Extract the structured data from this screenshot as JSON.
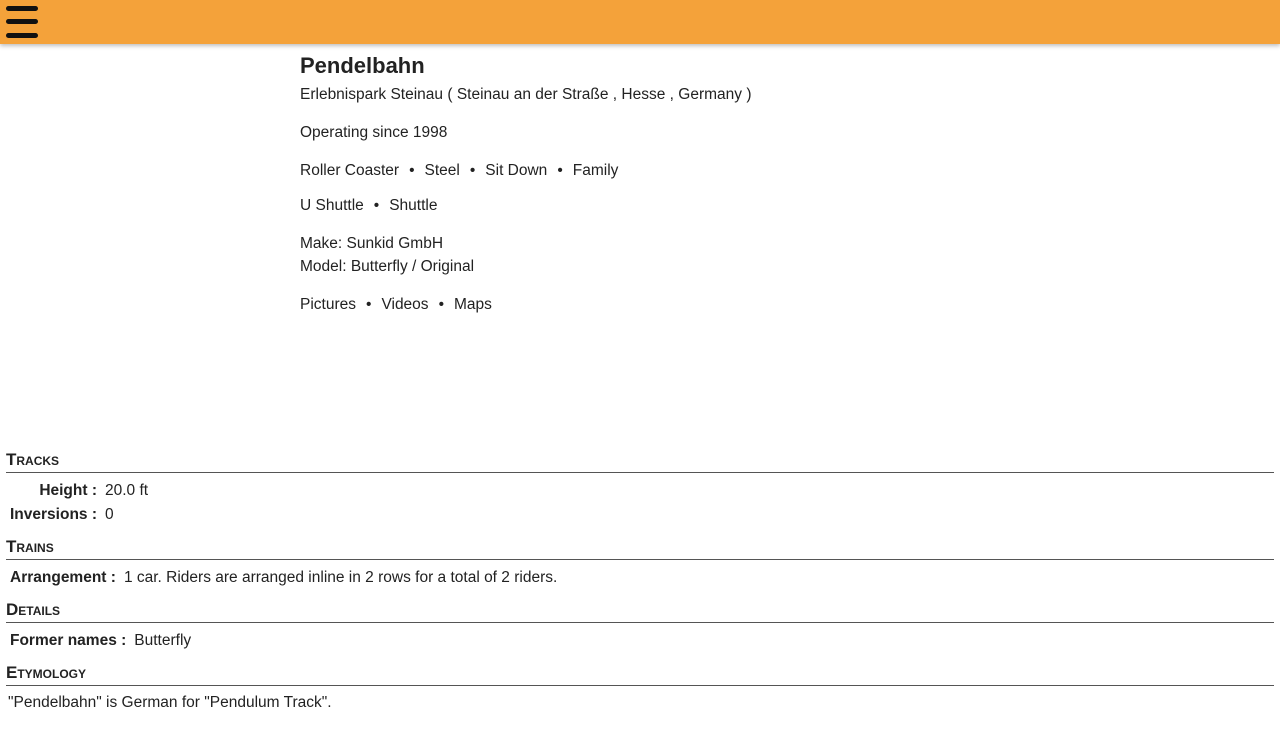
{
  "ride": {
    "name": "Pendelbahn",
    "park": "Erlebnispark Steinau",
    "city": "Steinau an der Straße",
    "region": "Hesse",
    "country": "Germany",
    "operating": "Operating since 1998",
    "tags_primary": [
      "Roller Coaster",
      "Steel",
      "Sit Down",
      "Family"
    ],
    "tags_secondary": [
      "U Shuttle",
      "Shuttle"
    ],
    "make_label": "Make:",
    "make": "Sunkid GmbH",
    "model_label": "Model:",
    "model": "Butterfly / Original",
    "links": [
      "Pictures",
      "Videos",
      "Maps"
    ],
    "separator": "•"
  },
  "sections": {
    "tracks": {
      "title": "Tracks",
      "rows": [
        {
          "label": "Height :",
          "value": "20.0 ft"
        },
        {
          "label": "Inversions :",
          "value": "0"
        }
      ]
    },
    "trains": {
      "title": "Trains",
      "rows": [
        {
          "label": "Arrangement :",
          "value": "1 car. Riders are arranged inline in 2 rows for a total of 2 riders."
        }
      ]
    },
    "details": {
      "title": "Details",
      "rows": [
        {
          "label": "Former names :",
          "value": "Butterfly"
        }
      ]
    },
    "etymology": {
      "title": "Etymology",
      "text": "\"Pendelbahn\" is German for \"Pendulum Track\"."
    }
  },
  "icons": {
    "menu": "hamburger-menu-icon"
  },
  "colors": {
    "topbar": "#f4a23a",
    "text": "#222222"
  }
}
